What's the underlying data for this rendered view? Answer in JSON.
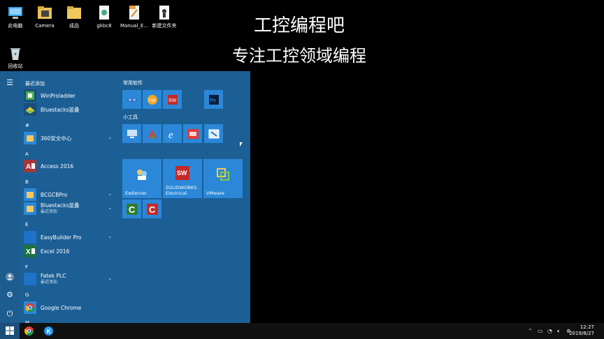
{
  "desktop": {
    "icons": [
      {
        "label": "此电脑",
        "icon": "computer-icon"
      },
      {
        "label": "Camera",
        "icon": "folder-icon"
      },
      {
        "label": "成品",
        "icon": "folder-icon"
      },
      {
        "label": "gkbc8",
        "icon": "file-icon"
      },
      {
        "label": "Manual_E...",
        "icon": "pdf-icon"
      },
      {
        "label": "新建文件夹",
        "icon": "folder-icon"
      },
      {
        "label": "回收站",
        "icon": "recycle-bin-icon"
      }
    ]
  },
  "overlay": {
    "line1": "工控编程吧",
    "line2": "专注工控领域编程"
  },
  "start_menu": {
    "recent_title": "最近添加",
    "recent": [
      {
        "name": "WinProladder"
      },
      {
        "name": "Bluestacks蓝叠"
      }
    ],
    "sections": [
      {
        "letter": "#",
        "apps": [
          {
            "name": "360安全中心",
            "expandable": true
          }
        ]
      },
      {
        "letter": "A",
        "apps": [
          {
            "name": "Access 2016"
          }
        ]
      },
      {
        "letter": "B",
        "apps": [
          {
            "name": "BCGCBPro",
            "expandable": true
          },
          {
            "name": "Bluestacks蓝叠",
            "sub": "最近添加",
            "expandable": true
          }
        ]
      },
      {
        "letter": "E",
        "apps": [
          {
            "name": "EasyBuilder Pro",
            "expandable": true
          },
          {
            "name": "Excel 2016"
          }
        ]
      },
      {
        "letter": "F",
        "apps": [
          {
            "name": "Fatek PLC",
            "sub": "最近添加",
            "expandable": true
          }
        ]
      },
      {
        "letter": "G",
        "apps": [
          {
            "name": "Google Chrome"
          }
        ]
      },
      {
        "letter": "M",
        "apps": []
      }
    ],
    "tile_groups": [
      {
        "title": "常用软件"
      },
      {
        "title": "小工具"
      }
    ],
    "large_tiles": [
      {
        "label": "EwServer"
      },
      {
        "label": "SOLIDWORKS Electrical"
      },
      {
        "label": "VMware"
      }
    ]
  },
  "taskbar": {
    "time": "12:27",
    "date": "2019/8/27"
  },
  "colors": {
    "start_bg": "#1c5f95",
    "tile": "#2b88d8",
    "taskbar": "#101010"
  }
}
